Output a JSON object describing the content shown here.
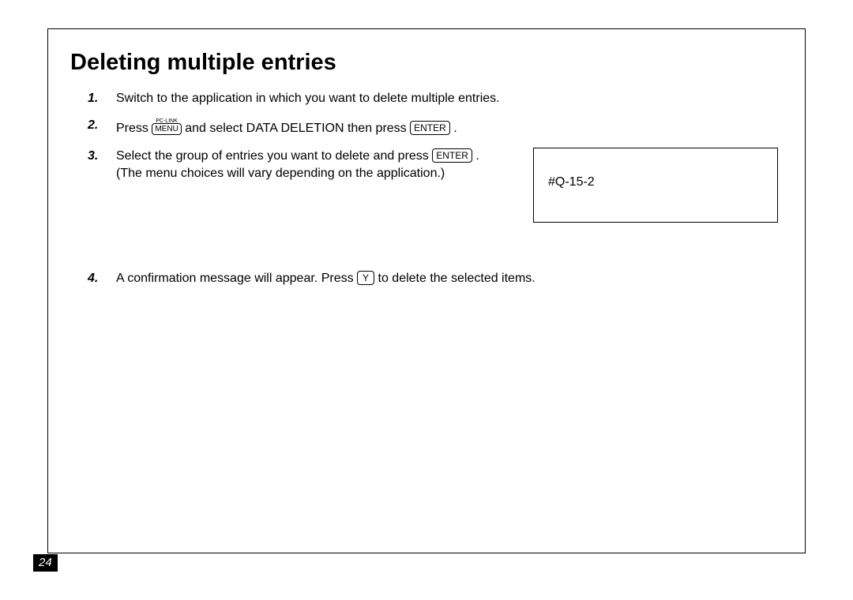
{
  "title": "Deleting multiple entries",
  "steps": {
    "n1": "1.",
    "s1": "Switch to the application in which you want to delete multiple entries.",
    "n2": "2.",
    "s2a": "Press ",
    "pc_link": "PC-LINK",
    "menu": "MENU",
    "s2b": " and select DATA DELETION then press ",
    "enter": "ENTER",
    "s2c": " .",
    "n3": "3.",
    "s3a": "Select the group of entries you want to delete and press ",
    "s3b": " .",
    "s3c": "(The menu choices will vary depending on the application.)",
    "n4": "4.",
    "s4a": "A confirmation message will appear. Press ",
    "y": "Y",
    "s4b": " to delete the selected items."
  },
  "ref": "#Q-15-2",
  "page": "24"
}
